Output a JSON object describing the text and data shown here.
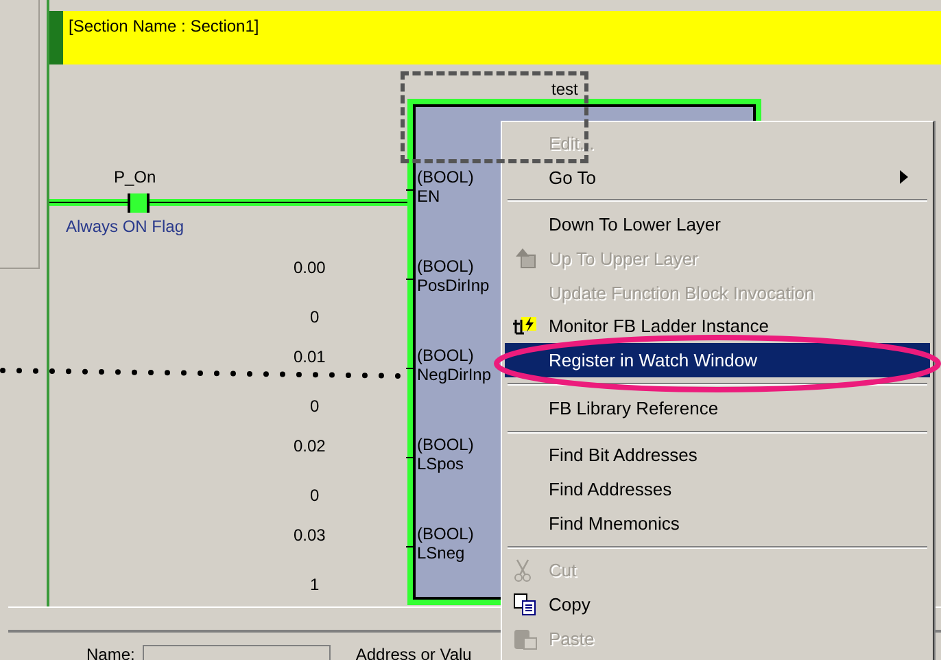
{
  "section_header": "[Section Name : Section1]",
  "contact": {
    "name": "P_On",
    "comment": "Always ON Flag",
    "on": true
  },
  "function_block": {
    "title": "test",
    "selected": true,
    "inputs": [
      {
        "type": "(BOOL)",
        "name": "EN"
      },
      {
        "type": "(BOOL)",
        "name": "PosDirInp",
        "address": "0.00",
        "value": "0"
      },
      {
        "type": "(BOOL)",
        "name": "NegDirInp",
        "address": "0.01",
        "value": "0"
      },
      {
        "type": "(BOOL)",
        "name": "LSpos",
        "address": "0.02",
        "value": "0"
      },
      {
        "type": "(BOOL)",
        "name": "LSneg",
        "address": "0.03",
        "value": "1"
      }
    ]
  },
  "context_menu": {
    "items": [
      {
        "kind": "item",
        "label": "Edit...",
        "disabled": true,
        "selected": false
      },
      {
        "kind": "submenu",
        "label": "Go To",
        "disabled": false,
        "selected": false
      },
      {
        "kind": "separator"
      },
      {
        "kind": "item",
        "label": "Down To Lower Layer",
        "disabled": false,
        "selected": false
      },
      {
        "kind": "item",
        "label": "Up To Upper Layer",
        "disabled": true,
        "selected": false
      },
      {
        "kind": "item",
        "label": "Update Function Block Invocation",
        "disabled": true,
        "selected": false
      },
      {
        "kind": "item",
        "label": "Monitor FB Ladder Instance",
        "disabled": false,
        "selected": false
      },
      {
        "kind": "item",
        "label": "Register in Watch Window",
        "disabled": false,
        "selected": true
      },
      {
        "kind": "separator"
      },
      {
        "kind": "item",
        "label": "FB Library Reference",
        "disabled": false,
        "selected": false
      },
      {
        "kind": "separator"
      },
      {
        "kind": "item",
        "label": "Find Bit Addresses",
        "disabled": false,
        "selected": false
      },
      {
        "kind": "item",
        "label": "Find Addresses",
        "disabled": false,
        "selected": false
      },
      {
        "kind": "item",
        "label": "Find Mnemonics",
        "disabled": false,
        "selected": false
      },
      {
        "kind": "separator"
      },
      {
        "kind": "item",
        "label": "Cut",
        "disabled": true,
        "selected": false
      },
      {
        "kind": "item",
        "label": "Copy",
        "disabled": false,
        "selected": false
      },
      {
        "kind": "item",
        "label": "Paste",
        "disabled": true,
        "selected": false
      }
    ]
  },
  "bottom_panel": {
    "name_label": "Name:",
    "address_label": "Address or Valu"
  }
}
